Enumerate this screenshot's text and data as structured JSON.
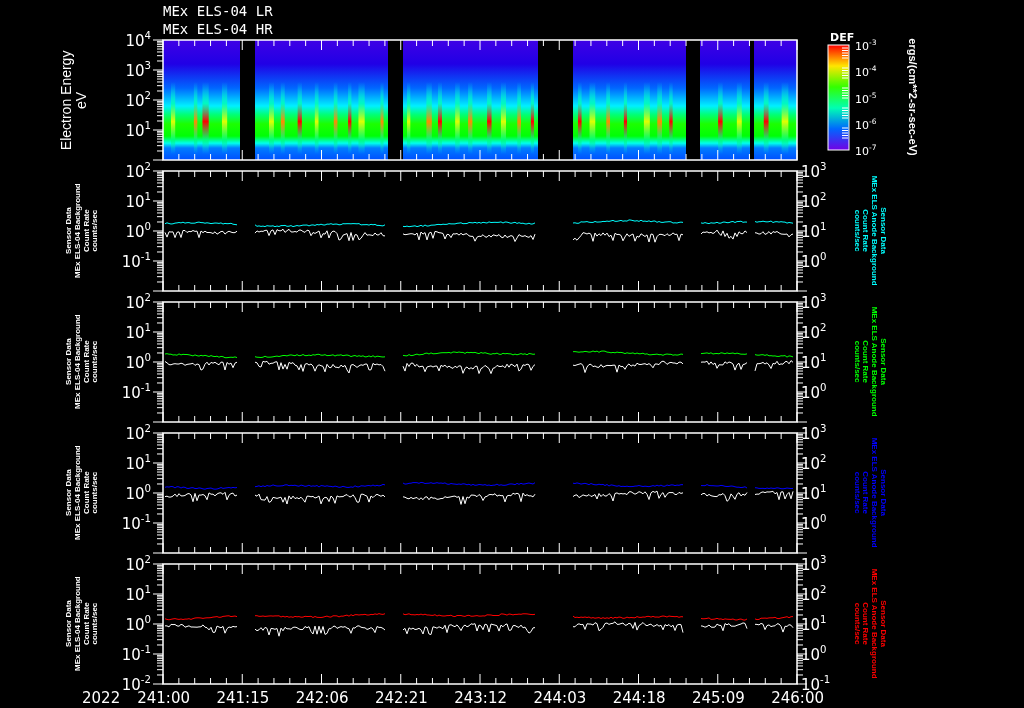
{
  "title_lines": [
    "MEx ELS-04 LR",
    "MEx ELS-04 HR"
  ],
  "spectrogram": {
    "ylabel": "Electron Energy",
    "yunit": "eV",
    "yticks": [
      "10$^{4}$",
      "10$^{3}$",
      "10$^{2}$",
      "10$^{1}$"
    ],
    "colorbar": {
      "title": "DEF",
      "ticks": [
        "10$^{-3}$",
        "10$^{-4}$",
        "10$^{-5}$",
        "10$^{-6}$",
        "10$^{-7}$"
      ],
      "units": "ergs/(cm**2-sr-sec-eV)"
    }
  },
  "panels": [
    {
      "left_label": [
        "Sensor Data",
        "MEx ELS-04 Background",
        "Count Rate",
        "counts/sec"
      ],
      "right_label": [
        "Sensor Data",
        "MEx ELS Anode Background",
        "Count Rate",
        "counts/sec"
      ],
      "left_ticks": [
        "10$^{2}$",
        "10$^{1}$",
        "10$^{0}$",
        "10$^{-1}$"
      ],
      "right_ticks": [
        "10$^{3}$",
        "10$^{2}$",
        "10$^{1}$",
        "10$^{0}$"
      ],
      "color": "#00ffff"
    },
    {
      "left_label": [
        "Sensor Data",
        "MEx ELS-04 Background",
        "Count Rate",
        "counts/sec"
      ],
      "right_label": [
        "Sensor Data",
        "MEx ELS Anode Background",
        "Count Rate",
        "counts/sec"
      ],
      "left_ticks": [
        "10$^{2}$",
        "10$^{1}$",
        "10$^{0}$",
        "10$^{-1}$"
      ],
      "right_ticks": [
        "10$^{3}$",
        "10$^{2}$",
        "10$^{1}$",
        "10$^{0}$"
      ],
      "color": "#00ff00"
    },
    {
      "left_label": [
        "Sensor Data",
        "MEx ELS-04 Background",
        "Count Rate",
        "counts/sec"
      ],
      "right_label": [
        "Sensor Data",
        "MEx ELS Anode Background",
        "Count Rate",
        "counts/sec"
      ],
      "left_ticks": [
        "10$^{2}$",
        "10$^{1}$",
        "10$^{0}$",
        "10$^{-1}$"
      ],
      "right_ticks": [
        "10$^{3}$",
        "10$^{2}$",
        "10$^{1}$",
        "10$^{0}$"
      ],
      "color": "#0000ff"
    },
    {
      "left_label": [
        "Sensor Data",
        "MEx ELS-04 Background",
        "Count Rate",
        "counts/sec"
      ],
      "right_label": [
        "Sensor Data",
        "MEx ELS Anode Background",
        "Count Rate",
        "counts/sec"
      ],
      "left_ticks": [
        "10$^{2}$",
        "10$^{1}$",
        "10$^{0}$",
        "10$^{-1}$",
        "10$^{-2}$"
      ],
      "right_ticks": [
        "10$^{3}$",
        "10$^{2}$",
        "10$^{1}$",
        "10$^{0}$",
        "10$^{-1}$"
      ],
      "color": "#ff0000"
    }
  ],
  "year": "2022",
  "time_ticks": [
    "241:00",
    "241:15",
    "242:06",
    "242:21",
    "243:12",
    "244:03",
    "244:18",
    "245:09",
    "246:00"
  ]
}
